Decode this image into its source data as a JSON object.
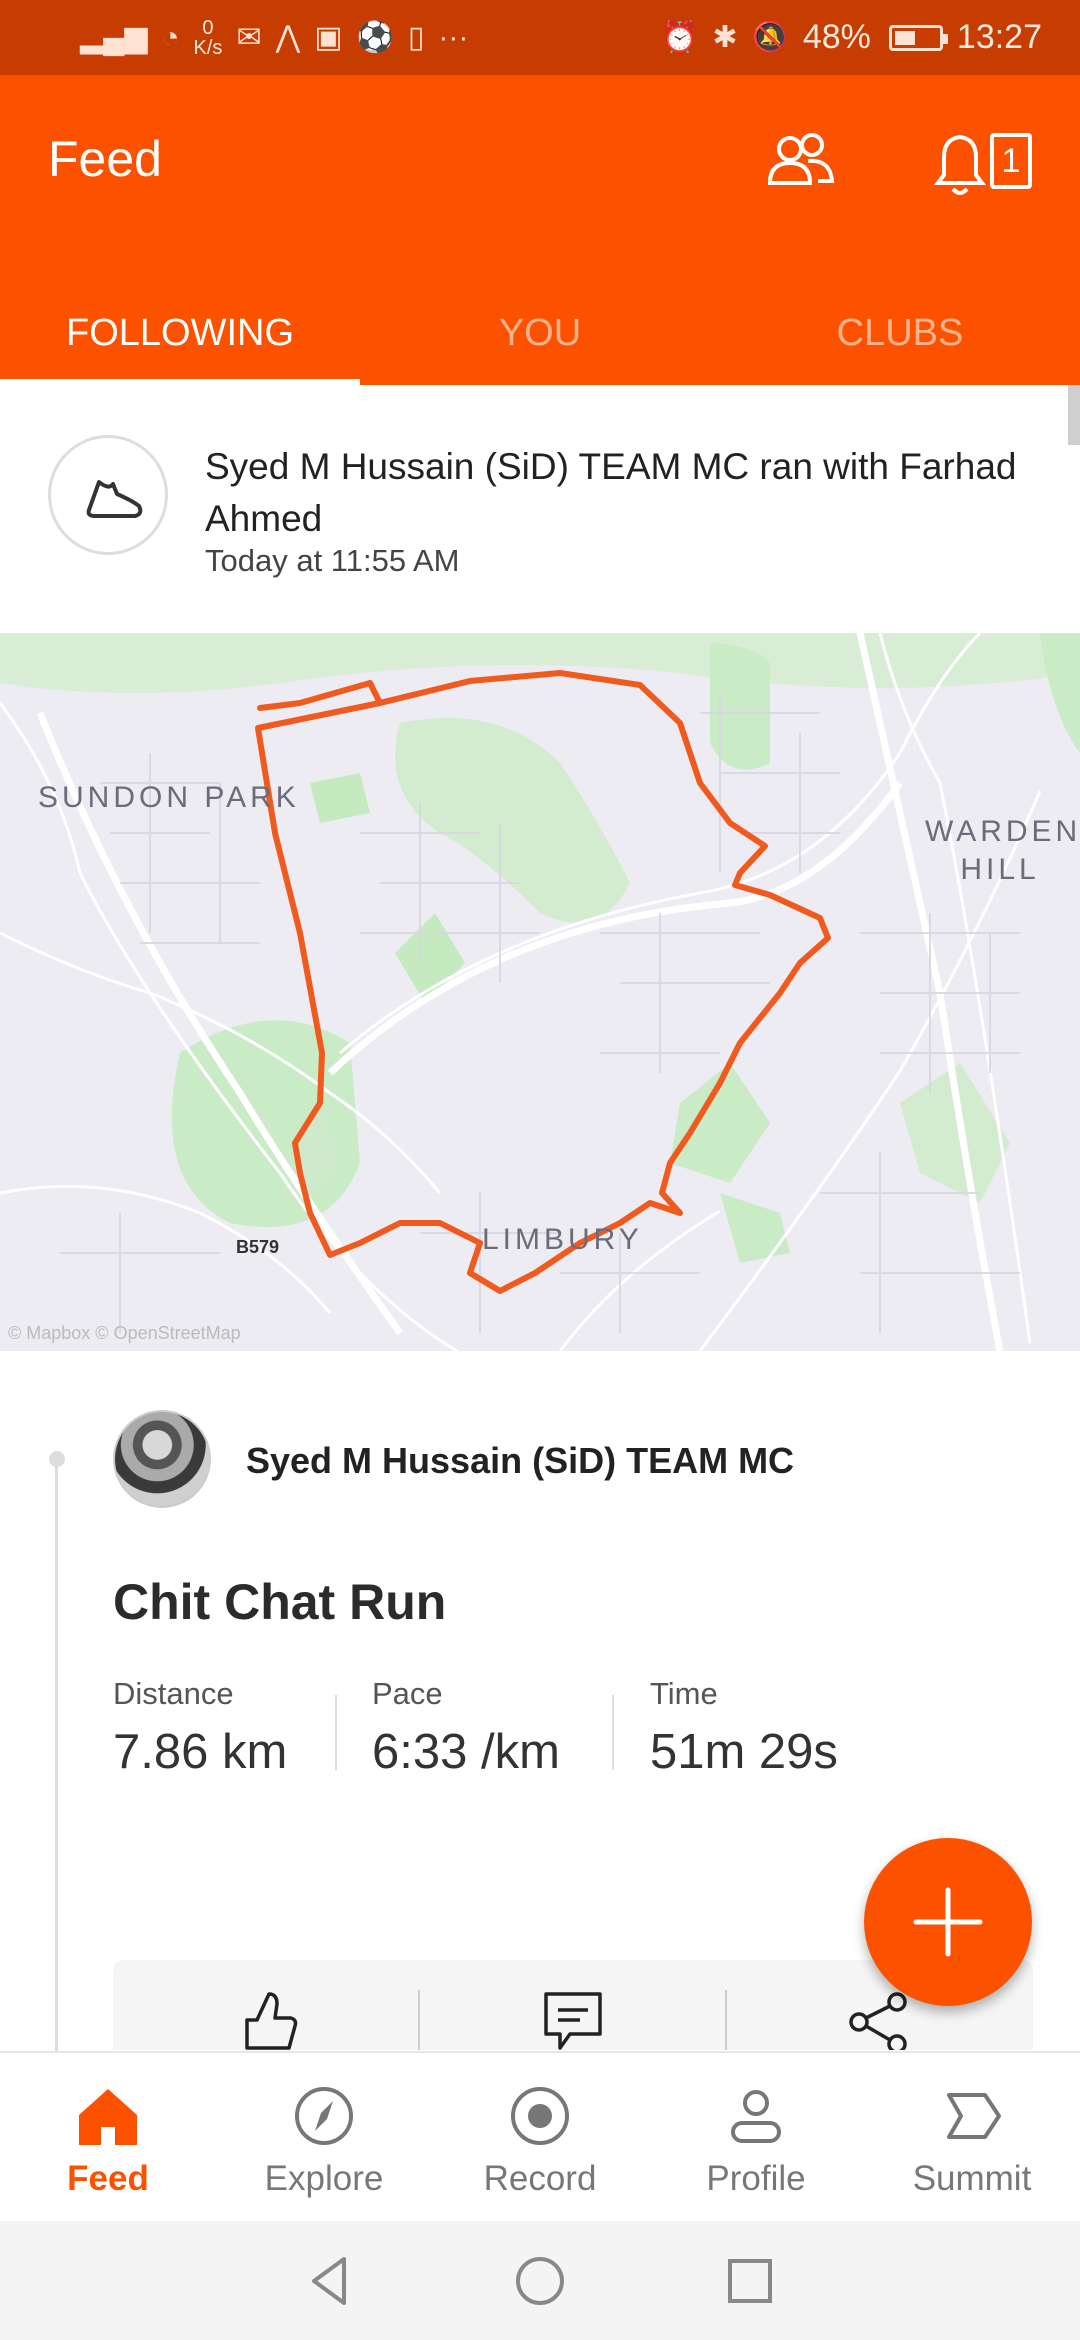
{
  "status_bar": {
    "speed_value": "0",
    "speed_unit": "K/s",
    "battery": "48%",
    "battery_level": 0.48,
    "time": "13:27",
    "more": "···"
  },
  "header": {
    "title": "Feed",
    "notification_count": "1"
  },
  "tabs": [
    {
      "label": "FOLLOWING",
      "active": true
    },
    {
      "label": "YOU",
      "active": false
    },
    {
      "label": "CLUBS",
      "active": false
    }
  ],
  "activity_header": {
    "text": "Syed M Hussain (SiD) TEAM MC ran with Farhad Ahmed",
    "time": "Today at 11:55 AM"
  },
  "map": {
    "labels": [
      "SUNDON PARK",
      "WARDEN HILL",
      "LIMBURY"
    ],
    "road": "B579",
    "attribution": "© Mapbox © OpenStreetMap",
    "route_color": "#f05a1e"
  },
  "activity": {
    "athlete": "Syed M Hussain (SiD) TEAM MC",
    "title": "Chit Chat Run",
    "stats": [
      {
        "label": "Distance",
        "value": "7.86 km"
      },
      {
        "label": "Pace",
        "value": "6:33 /km"
      },
      {
        "label": "Time",
        "value": "51m 29s"
      }
    ]
  },
  "bottom_nav": [
    {
      "label": "Feed",
      "icon": "home-icon",
      "active": true
    },
    {
      "label": "Explore",
      "icon": "compass-icon",
      "active": false
    },
    {
      "label": "Record",
      "icon": "record-icon",
      "active": false
    },
    {
      "label": "Profile",
      "icon": "person-icon",
      "active": false
    },
    {
      "label": "Summit",
      "icon": "summit-icon",
      "active": false
    }
  ],
  "colors": {
    "brand": "#fc5200",
    "status_bar": "#c73c00"
  }
}
